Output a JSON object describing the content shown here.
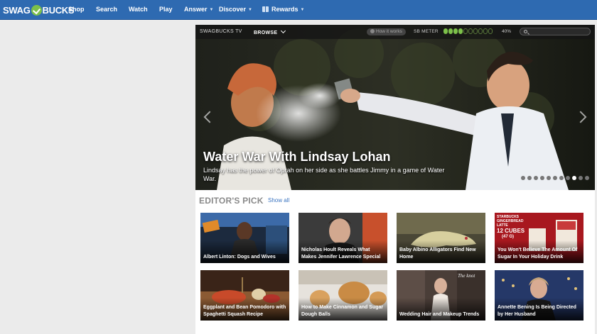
{
  "brand": {
    "logo_left": "SWAG",
    "logo_right": "BUCKS"
  },
  "nav": {
    "items": [
      {
        "label": "Shop"
      },
      {
        "label": "Search"
      },
      {
        "label": "Watch"
      },
      {
        "label": "Play"
      },
      {
        "label": "Answer"
      },
      {
        "label": "Discover"
      },
      {
        "label": "Rewards"
      }
    ]
  },
  "tvbar": {
    "title": "SWAGBUCKS TV",
    "browse": "BROWSE",
    "how": "How it works",
    "meter_label": "SB METER",
    "meter_filled": 4,
    "meter_total": 10,
    "meter_pct": "40%",
    "search_placeholder": ""
  },
  "hero": {
    "title": "Water War With Lindsay Lohan",
    "description": "Lindsay has the power of Oprah on her side as she battles Jimmy in a game of Water War.",
    "pager_count": 11,
    "pager_active": 8
  },
  "editors": {
    "heading": "EDITOR'S PICK",
    "show_all": "Show all",
    "tiles": [
      {
        "caption": "Albert Linton: Dogs and Wives"
      },
      {
        "caption": "Nicholas Hoult Reveals What Makes Jennifer Lawrence Special"
      },
      {
        "caption": "Baby Albino Alligators Find New Home"
      },
      {
        "caption": "You Won't Believe The Amount Of Sugar In Your Holiday Drink",
        "overlay_top": "STARBUCKS GINGERBREAD LATTE",
        "overlay_mid": "12 CUBES",
        "overlay_sub": "(47 G)"
      },
      {
        "caption": "Eggplant and Bean Pomodoro with Spaghetti Squash Recipe"
      },
      {
        "caption": "How to Make Cinnamon and Sugar Dough Balls"
      },
      {
        "caption": "Wedding Hair and Makeup Trends",
        "overlay_top": "The knot"
      },
      {
        "caption": "Annette Bening Is Being Directed by Her Husband"
      }
    ]
  },
  "colors": {
    "nav": "#2e6ab1",
    "accent_green": "#7cc04a",
    "link": "#3a74c0"
  }
}
